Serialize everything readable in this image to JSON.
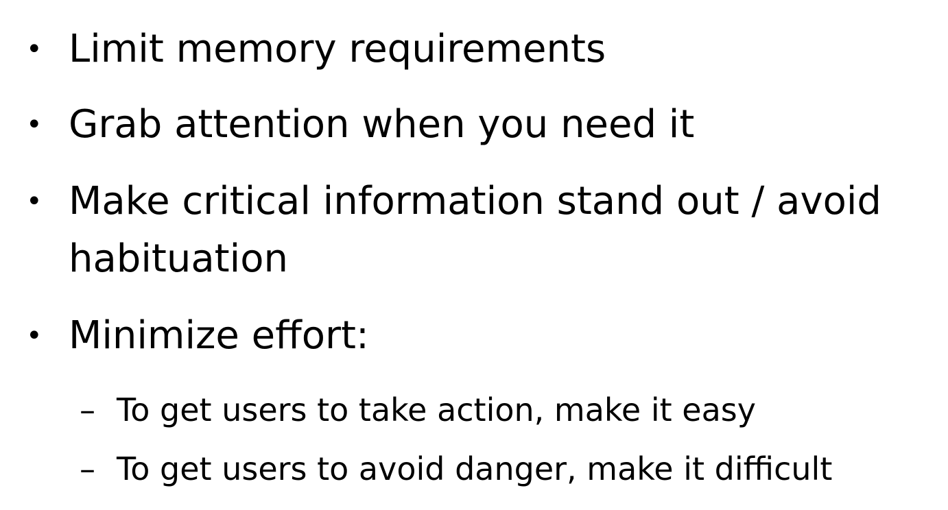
{
  "bullets": [
    "Limit memory requirements",
    "Grab attention when you need it",
    "Make critical information stand out / avoid habituation",
    "Minimize effort:"
  ],
  "sub_bullets": [
    "To get users to take action, make it easy",
    "To get users to avoid danger, make it difficult"
  ],
  "bullet_glyph": "•",
  "dash_glyph": "–"
}
